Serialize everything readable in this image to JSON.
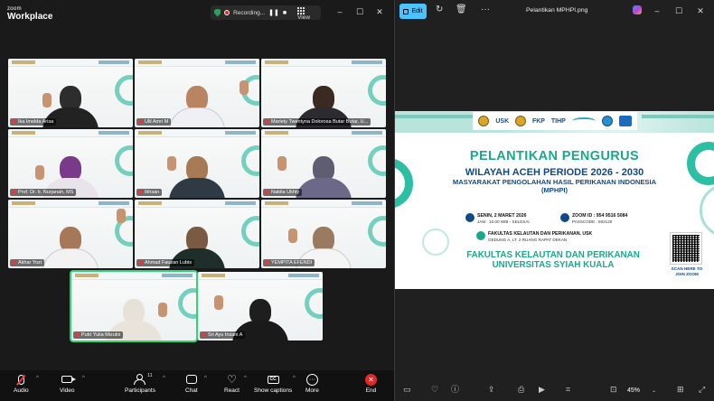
{
  "zoom": {
    "logo_top": "zoom",
    "logo_bottom": "Workplace",
    "recording_label": "Recording...",
    "view_label": "View",
    "window_buttons": [
      "–",
      "☐",
      "✕"
    ],
    "participants": [
      {
        "name": "Ika Imelda Arisa",
        "muted": true,
        "active": false
      },
      {
        "name": "Ulil Amri M",
        "muted": true,
        "active": false
      },
      {
        "name": "Mariety Twentyna Dolorosa Butar Butar, U...",
        "muted": true,
        "active": false
      },
      {
        "name": "Prof. Dr. Ir. Nurjanah, MS",
        "muted": true,
        "active": false
      },
      {
        "name": "Ikhsan",
        "muted": true,
        "active": false
      },
      {
        "name": "Nabila Ukhty",
        "muted": true,
        "active": false
      },
      {
        "name": "Akhar Yozi",
        "muted": true,
        "active": false
      },
      {
        "name": "Ahmad Fauzan Lubis",
        "muted": true,
        "active": false
      },
      {
        "name": "YEMPITA EFENDI",
        "muted": true,
        "active": false
      },
      {
        "name": "Putri Yulia Mizulni",
        "muted": true,
        "active": true
      },
      {
        "name": "Sri Ayu Insani A",
        "muted": true,
        "active": false
      }
    ],
    "toolbar": {
      "audio": "Audio",
      "video": "Video",
      "participants": "Participants",
      "participants_count": "11",
      "chat": "Chat",
      "react": "React",
      "captions": "Show captions",
      "more": "More",
      "end": "End"
    }
  },
  "viewer": {
    "edit_label": "Edit",
    "title": "Pelantikan MPHPI.png",
    "window_buttons": [
      "–",
      "☐",
      "✕"
    ],
    "zoom_level": "45%",
    "flyer": {
      "logos": [
        "USK",
        "FKP",
        "TIHP"
      ],
      "heading1": "PELANTIKAN PENGURUS",
      "heading2": "WILAYAH ACEH PERIODE 2026 - 2030",
      "heading3_line1": "MASYARAKAT PENGOLAHAN HASIL PERIKANAN INDONESIA",
      "heading3_line2": "(MPHPI)",
      "date_line1": "SENIN, 2 MARET 2026",
      "date_line2": "JAM : 10.00 WIB - SELESAI",
      "zoom_line1": "ZOOM ID   : 954 9516 5084",
      "zoom_line2": "PASSCODE : 502120",
      "place_line1": "FAKULTAS KELAUTAN DAN PERIKANAN, USK",
      "place_line2": "GEDUNG A, LT. 2 RUANG RAPAT DEKAN",
      "faculty_line1": "FAKULTAS KELAUTAN DAN PERIKANAN",
      "faculty_line2": "UNIVERSITAS SYIAH KUALA",
      "qr_line1": "SCAN HERE TO",
      "qr_line2": "JOIN ZOOM"
    }
  },
  "colors": {
    "zoom_bg": "#1a1a1a",
    "accent_teal": "#1aa88d",
    "accent_navy": "#0f4a86",
    "edit_button": "#4cc2ff",
    "end_red": "#e02828",
    "active_speaker": "#2ed573"
  }
}
